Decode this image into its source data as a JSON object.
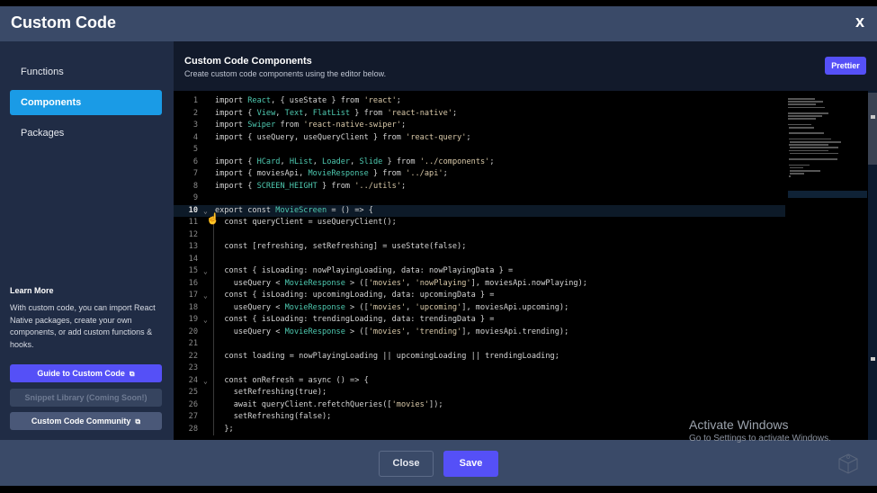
{
  "header": {
    "title": "Custom Code",
    "close_icon": "x"
  },
  "sidebar": {
    "items": [
      {
        "label": "Functions",
        "active": false
      },
      {
        "label": "Components",
        "active": true
      },
      {
        "label": "Packages",
        "active": false
      }
    ],
    "learn_more": {
      "title": "Learn More",
      "text": "With custom code, you can import React Native packages, create your own components, or add custom functions & hooks."
    },
    "buttons": {
      "guide": "Guide to Custom Code",
      "snippet": "Snippet Library (Coming Soon!)",
      "community": "Custom Code Community",
      "external_icon": "⧉"
    }
  },
  "main": {
    "title": "Custom Code Components",
    "subtitle": "Create custom code components using the editor below.",
    "prettier_label": "Prettier"
  },
  "editor": {
    "current_line": 10,
    "lines": [
      {
        "n": 1,
        "fold": false,
        "indent": false,
        "html": "import <span class='ty'>React</span>, { useState } from <span class='st2'>'react'</span>;"
      },
      {
        "n": 2,
        "fold": false,
        "indent": false,
        "html": "import { <span class='ty'>View</span>, <span class='ty'>Text</span>, <span class='ty'>FlatList</span> } from <span class='st2'>'react-native'</span>;"
      },
      {
        "n": 3,
        "fold": false,
        "indent": false,
        "html": "import <span class='ty'>Swiper</span> from <span class='st2'>'react-native-swiper'</span>;"
      },
      {
        "n": 4,
        "fold": false,
        "indent": false,
        "html": "import { useQuery, useQueryClient } from <span class='st2'>'react-query'</span>;"
      },
      {
        "n": 5,
        "fold": false,
        "indent": false,
        "html": ""
      },
      {
        "n": 6,
        "fold": false,
        "indent": false,
        "html": "import { <span class='ty'>HCard</span>, <span class='ty'>HList</span>, <span class='ty'>Loader</span>, <span class='ty'>Slide</span> } from <span class='st2'>'../components'</span>;"
      },
      {
        "n": 7,
        "fold": false,
        "indent": false,
        "html": "import { moviesApi, <span class='ty'>MovieResponse</span> } from <span class='st2'>'../api'</span>;"
      },
      {
        "n": 8,
        "fold": false,
        "indent": false,
        "html": "import { <span class='ty'>SCREEN_HEIGHT</span> } from <span class='st2'>'../utils'</span>;"
      },
      {
        "n": 9,
        "fold": false,
        "indent": false,
        "html": ""
      },
      {
        "n": 10,
        "fold": true,
        "indent": false,
        "html": "export const <span class='ty'>MovieScreen</span> = () =&gt; {"
      },
      {
        "n": 11,
        "fold": false,
        "indent": true,
        "html": "  const queryClient = useQueryClient();"
      },
      {
        "n": 12,
        "fold": false,
        "indent": true,
        "html": ""
      },
      {
        "n": 13,
        "fold": false,
        "indent": true,
        "html": "  const [refreshing, setRefreshing] = useState(false);"
      },
      {
        "n": 14,
        "fold": false,
        "indent": true,
        "html": ""
      },
      {
        "n": 15,
        "fold": true,
        "indent": true,
        "html": "  const { isLoading: nowPlayingLoading, data: nowPlayingData } ="
      },
      {
        "n": 16,
        "fold": false,
        "indent": true,
        "html": "    useQuery &lt; <span class='ty'>MovieResponse</span> &gt; ([<span class='st2'>'movies'</span>, <span class='st2'>'nowPlaying'</span>], moviesApi.nowPlaying);"
      },
      {
        "n": 17,
        "fold": true,
        "indent": true,
        "html": "  const { isLoading: upcomingLoading, data: upcomingData } ="
      },
      {
        "n": 18,
        "fold": false,
        "indent": true,
        "html": "    useQuery &lt; <span class='ty'>MovieResponse</span> &gt; ([<span class='st2'>'movies'</span>, <span class='st2'>'upcoming'</span>], moviesApi.upcoming);"
      },
      {
        "n": 19,
        "fold": true,
        "indent": true,
        "html": "  const { isLoading: trendingLoading, data: trendingData } ="
      },
      {
        "n": 20,
        "fold": false,
        "indent": true,
        "html": "    useQuery &lt; <span class='ty'>MovieResponse</span> &gt; ([<span class='st2'>'movies'</span>, <span class='st2'>'trending'</span>], moviesApi.trending);"
      },
      {
        "n": 21,
        "fold": false,
        "indent": true,
        "html": ""
      },
      {
        "n": 22,
        "fold": false,
        "indent": true,
        "html": "  const loading = nowPlayingLoading || upcomingLoading || trendingLoading;"
      },
      {
        "n": 23,
        "fold": false,
        "indent": true,
        "html": ""
      },
      {
        "n": 24,
        "fold": true,
        "indent": true,
        "html": "  const onRefresh = async () =&gt; {"
      },
      {
        "n": 25,
        "fold": false,
        "indent": true,
        "html": "    setRefreshing(true);"
      },
      {
        "n": 26,
        "fold": false,
        "indent": true,
        "html": "    await queryClient.refetchQueries([<span class='st2'>'movies'</span>]);"
      },
      {
        "n": 27,
        "fold": false,
        "indent": true,
        "html": "    setRefreshing(false);"
      },
      {
        "n": 28,
        "fold": false,
        "indent": true,
        "html": "  };"
      }
    ]
  },
  "footer": {
    "close_label": "Close",
    "save_label": "Save"
  },
  "watermark": {
    "title": "Activate Windows",
    "subtitle": "Go to Settings to activate Windows."
  },
  "colors": {
    "accent": "#5550f7",
    "active_nav": "#1a9be6",
    "header_bg": "#3a4a68",
    "sidebar_bg": "#202c45"
  }
}
